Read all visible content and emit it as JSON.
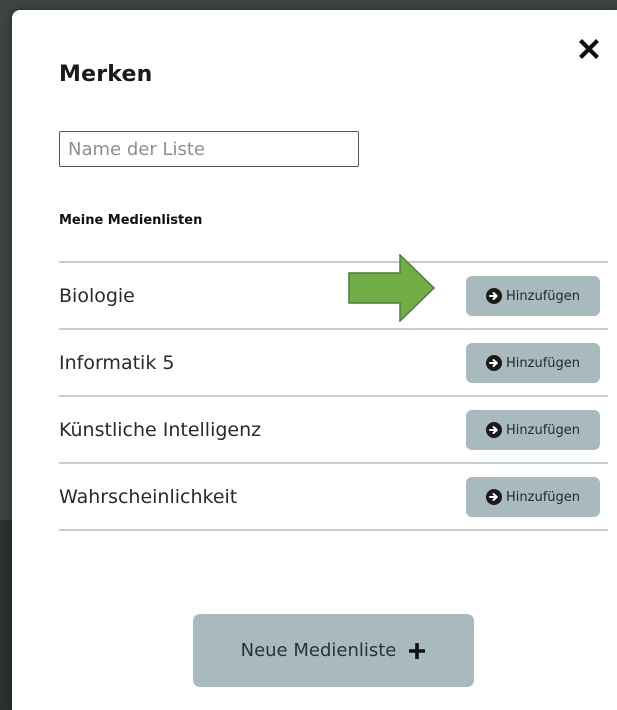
{
  "modal": {
    "title": "Merken",
    "close_icon": "close-icon",
    "list_name_input": {
      "value": "",
      "placeholder": "Name der Liste"
    },
    "section_heading": "Meine Medienlisten",
    "lists": [
      {
        "label": "Biologie",
        "button_label": "Hinzufügen",
        "button_icon": "arrow-circle-right-icon"
      },
      {
        "label": "Informatik 5",
        "button_label": "Hinzufügen",
        "button_icon": "arrow-circle-right-icon"
      },
      {
        "label": "Künstliche Intelligenz",
        "button_label": "Hinzufügen",
        "button_icon": "arrow-circle-right-icon"
      },
      {
        "label": "Wahrscheinlichkeit",
        "button_label": "Hinzufügen",
        "button_icon": "arrow-circle-right-icon"
      }
    ],
    "new_list_button": {
      "label": "Neue Medienliste",
      "icon": "plus-icon"
    }
  },
  "colors": {
    "button_bg": "#a9babf",
    "divider": "#c8cdd1",
    "highlight_arrow": "#70ad47"
  }
}
